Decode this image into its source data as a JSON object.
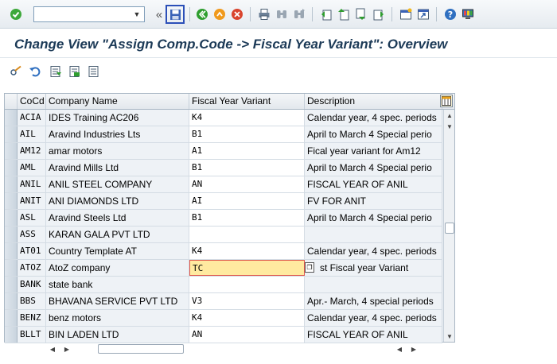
{
  "window": {
    "title": "Change View \"Assign Comp.Code -> Fiscal Year Variant\": Overview"
  },
  "toolbar": {
    "command_value": "",
    "icons": [
      "enter-icon",
      "expand-icon",
      "save-icon",
      "back-icon",
      "exit-icon",
      "cancel-icon",
      "print-icon",
      "find-icon",
      "find-next-icon",
      "first-page-icon",
      "prev-page-icon",
      "next-page-icon",
      "last-page-icon",
      "new-session-icon",
      "shortcut-icon",
      "help-icon",
      "layout-icon"
    ]
  },
  "app_toolbar": {
    "icons": [
      "change-display-icon",
      "undo-icon",
      "select-all-icon",
      "select-block-icon",
      "deselect-all-icon"
    ]
  },
  "table": {
    "columns": [
      "CoCd",
      "Company Name",
      "Fiscal Year Variant",
      "Description"
    ],
    "rows": [
      {
        "code": "ACIA",
        "name": "IDES Training AC206",
        "fyv": "K4",
        "desc": "Calendar year, 4 spec. periods"
      },
      {
        "code": "AIL",
        "name": "Aravind Industries Lts",
        "fyv": "B1",
        "desc": "April to March 4 Special perio"
      },
      {
        "code": "AM12",
        "name": "amar motors",
        "fyv": "A1",
        "desc": "Fical year variant for Am12"
      },
      {
        "code": "AML",
        "name": "Aravind Mills Ltd",
        "fyv": "B1",
        "desc": "April to March 4 Special perio"
      },
      {
        "code": "ANIL",
        "name": "ANIL STEEL COMPANY",
        "fyv": "AN",
        "desc": "FISCAL YEAR OF ANIL"
      },
      {
        "code": "ANIT",
        "name": "ANI DIAMONDS LTD",
        "fyv": "AI",
        "desc": "FV FOR ANIT"
      },
      {
        "code": "ASL",
        "name": "Aravind Steels Ltd",
        "fyv": "B1",
        "desc": "April to March 4 Special perio"
      },
      {
        "code": "ASS",
        "name": "KARAN GALA PVT LTD",
        "fyv": "",
        "desc": ""
      },
      {
        "code": "AT01",
        "name": "Country Template AT",
        "fyv": "K4",
        "desc": "Calendar year, 4 spec. periods"
      },
      {
        "code": "ATOZ",
        "name": "AtoZ company",
        "fyv": "TC",
        "desc": "st Fiscal year Variant"
      },
      {
        "code": "BANK",
        "name": "state bank",
        "fyv": "",
        "desc": ""
      },
      {
        "code": "BBS",
        "name": "BHAVANA SERVICE PVT LTD",
        "fyv": "V3",
        "desc": "Apr.- March, 4 special periods"
      },
      {
        "code": "BENZ",
        "name": "benz motors",
        "fyv": "K4",
        "desc": "Calendar year, 4 spec. periods"
      },
      {
        "code": "BLLT",
        "name": "BIN LADEN LTD",
        "fyv": "AN",
        "desc": "FISCAL YEAR OF ANIL"
      }
    ],
    "active_row": 9
  },
  "colors": {
    "title": "#1c3a57",
    "active_cell": "#ffeaa0",
    "active_border": "#e0584c",
    "save_highlight": "#2b4fb8"
  }
}
